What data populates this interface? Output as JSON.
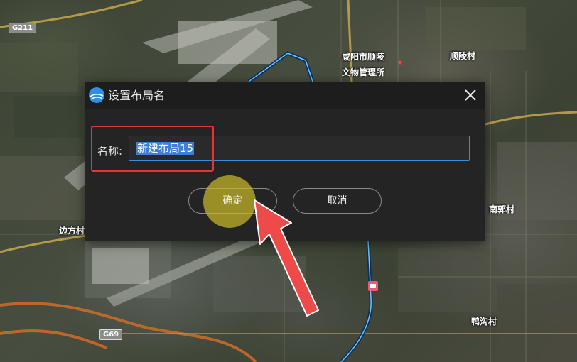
{
  "map": {
    "labels": {
      "shunling_museum_line1": "咸阳市顺陵",
      "shunling_museum_line2": "文物管理所",
      "shunling_village": "顺陵村",
      "nanguo_village": "南郭村",
      "bianfang_village": "边方村",
      "yagou_village": "鸭沟村"
    },
    "road_shields": {
      "g211": "G211",
      "g69": "G69"
    }
  },
  "dialog": {
    "title": "设置布局名",
    "name_label": "名称:",
    "name_value": "新建布局15",
    "ok_label": "确定",
    "cancel_label": "取消",
    "logo_icon": "app-logo-icon",
    "close_icon": "close-icon"
  },
  "annotations": {
    "highlight_color": "#e53535",
    "arrow_color": "#ef4a4a",
    "click_circle_color": "#c8b928"
  },
  "colors": {
    "dialog_bg": "#242425",
    "dialog_header_bg": "#1d1d1e",
    "input_border": "#3b8fd9",
    "selection_bg": "#3d7fd2"
  }
}
